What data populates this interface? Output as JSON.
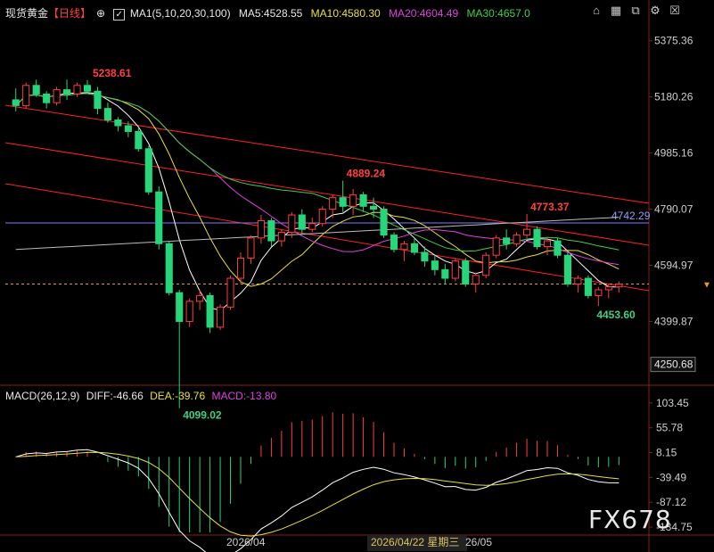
{
  "header": {
    "instrument": "现货黄金",
    "period": "【日线】",
    "ma_label": "MA1(5,10,20,30,100)",
    "ma5": "MA5:4528.55",
    "ma10": "MA10:4580.30",
    "ma20": "MA20:4604.49",
    "ma30": "MA30:4657.0",
    "toolbar": [
      "home-icon",
      "chart-icon",
      "compare-icon",
      "settings-icon",
      "collapse-icon"
    ]
  },
  "macd_header": {
    "label": "MACD(26,12,9)",
    "diff": "DIFF:-46.66",
    "dea": "DEA:-39.76",
    "macd": "MACD:-13.80"
  },
  "colors": {
    "up": "#ff3d3d",
    "down": "#27d67a",
    "ma5": "#ffffff",
    "ma10": "#e8e03a",
    "ma20": "#e040e0",
    "ma30": "#40d040",
    "ma100": "#bbbbbb",
    "channel": "#ff2020",
    "hline": "#7b7bff"
  },
  "chart_data": {
    "type": "candlestick",
    "price_axis_ticks": [
      "5375.36",
      "5180.26",
      "4985.16",
      "4790.07",
      "4594.97",
      "4399.87"
    ],
    "price_range": [
      4200,
      5430
    ],
    "current_price": "4250.68",
    "annotations": {
      "high": "5238.61",
      "low": "4099.02",
      "mid_high": "4889.24",
      "recent_high": "4773.37",
      "recent_low": "4453.60",
      "hline": "4742.29"
    },
    "x_labels": [
      "2026/04",
      "2026/04/22 星期三",
      "26/05"
    ],
    "macd_axis_ticks": [
      "103.45",
      "55.78",
      "8.15",
      "-39.49",
      "-87.12",
      "-134.75"
    ],
    "macd_range": [
      -150,
      110
    ],
    "candles": [
      [
        5170,
        5210,
        5130,
        5150
      ],
      [
        5150,
        5230,
        5140,
        5220
      ],
      [
        5220,
        5240,
        5180,
        5190
      ],
      [
        5190,
        5200,
        5140,
        5160
      ],
      [
        5160,
        5215,
        5150,
        5205
      ],
      [
        5205,
        5240,
        5170,
        5190
      ],
      [
        5190,
        5230,
        5180,
        5220
      ],
      [
        5220,
        5238.61,
        5190,
        5200
      ],
      [
        5200,
        5215,
        5120,
        5140
      ],
      [
        5140,
        5160,
        5090,
        5100
      ],
      [
        5100,
        5110,
        5060,
        5080
      ],
      [
        5080,
        5095,
        5040,
        5060
      ],
      [
        5060,
        5075,
        4990,
        5000
      ],
      [
        5000,
        5010,
        4840,
        4850
      ],
      [
        4850,
        4870,
        4650,
        4670
      ],
      [
        4670,
        4680,
        4490,
        4500
      ],
      [
        4500,
        4510,
        4099.02,
        4400
      ],
      [
        4400,
        4480,
        4380,
        4470
      ],
      [
        4470,
        4510,
        4440,
        4490
      ],
      [
        4490,
        4500,
        4360,
        4380
      ],
      [
        4380,
        4460,
        4370,
        4450
      ],
      [
        4450,
        4560,
        4440,
        4550
      ],
      [
        4550,
        4640,
        4530,
        4620
      ],
      [
        4620,
        4700,
        4600,
        4690
      ],
      [
        4690,
        4770,
        4670,
        4750
      ],
      [
        4750,
        4760,
        4660,
        4680
      ],
      [
        4680,
        4720,
        4660,
        4710
      ],
      [
        4710,
        4780,
        4690,
        4770
      ],
      [
        4770,
        4790,
        4700,
        4720
      ],
      [
        4720,
        4760,
        4710,
        4740
      ],
      [
        4740,
        4800,
        4730,
        4790
      ],
      [
        4790,
        4840,
        4760,
        4830
      ],
      [
        4830,
        4889.24,
        4780,
        4800
      ],
      [
        4800,
        4860,
        4770,
        4840
      ],
      [
        4840,
        4850,
        4780,
        4800
      ],
      [
        4800,
        4830,
        4760,
        4790
      ],
      [
        4790,
        4800,
        4690,
        4700
      ],
      [
        4700,
        4710,
        4640,
        4650
      ],
      [
        4650,
        4680,
        4610,
        4670
      ],
      [
        4670,
        4690,
        4630,
        4640
      ],
      [
        4640,
        4660,
        4590,
        4610
      ],
      [
        4610,
        4630,
        4560,
        4580
      ],
      [
        4580,
        4600,
        4530,
        4550
      ],
      [
        4550,
        4620,
        4540,
        4610
      ],
      [
        4610,
        4620,
        4520,
        4530
      ],
      [
        4530,
        4570,
        4500,
        4560
      ],
      [
        4560,
        4640,
        4550,
        4630
      ],
      [
        4630,
        4700,
        4620,
        4690
      ],
      [
        4690,
        4720,
        4650,
        4670
      ],
      [
        4670,
        4710,
        4660,
        4700
      ],
      [
        4700,
        4773.37,
        4690,
        4720
      ],
      [
        4720,
        4730,
        4650,
        4660
      ],
      [
        4660,
        4690,
        4630,
        4680
      ],
      [
        4680,
        4690,
        4620,
        4630
      ],
      [
        4630,
        4640,
        4520,
        4530
      ],
      [
        4530,
        4560,
        4500,
        4550
      ],
      [
        4550,
        4560,
        4480,
        4490
      ],
      [
        4490,
        4520,
        4453.6,
        4510
      ],
      [
        4510,
        4530,
        4480,
        4520
      ],
      [
        4520,
        4540,
        4500,
        4530
      ]
    ]
  }
}
